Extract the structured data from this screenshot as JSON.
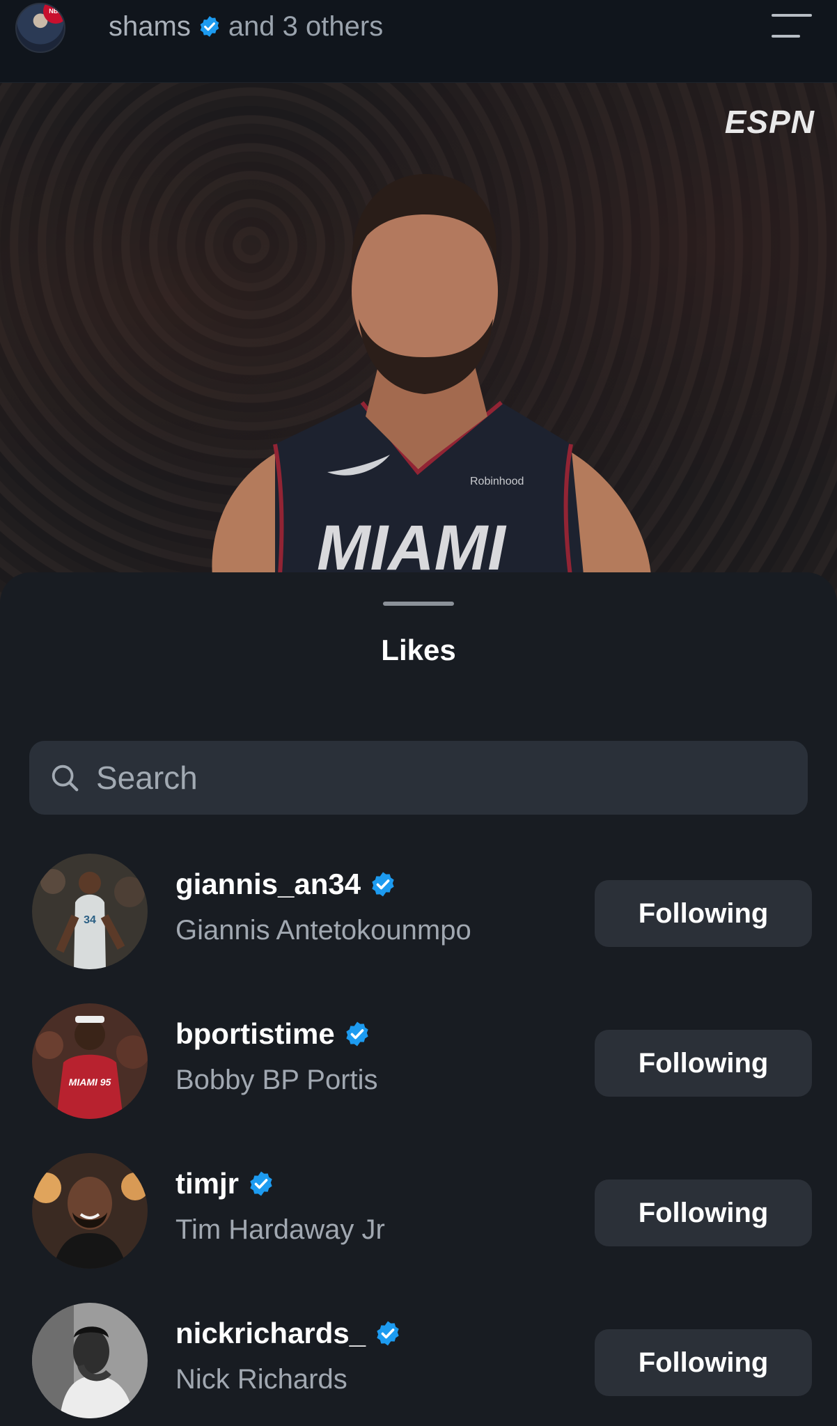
{
  "header": {
    "account": "shams",
    "others": "and 3 others",
    "avatar_badge": "NBA"
  },
  "photo": {
    "broadcaster_logo": "ESPN",
    "jersey_text": "MIAMI",
    "sponsor": "Robinhood"
  },
  "sheet": {
    "title": "Likes",
    "search_placeholder": "Search"
  },
  "likes": [
    {
      "username": "giannis_an34",
      "name": "Giannis Antetokounmpo",
      "verified": true,
      "button": "Following",
      "avatar_jersey": "34"
    },
    {
      "username": "bportistime",
      "name": "Bobby BP Portis",
      "verified": true,
      "button": "Following",
      "avatar_jersey": "MIAMI 95"
    },
    {
      "username": "timjr",
      "name": "Tim Hardaway Jr",
      "verified": true,
      "button": "Following"
    },
    {
      "username": "nickrichards_",
      "name": "Nick Richards",
      "verified": true,
      "button": "Following"
    }
  ],
  "colors": {
    "background": "#171b21",
    "button": "#2b3038",
    "verified": "#1d9bf0",
    "muted_text": "#a1a8b1"
  }
}
